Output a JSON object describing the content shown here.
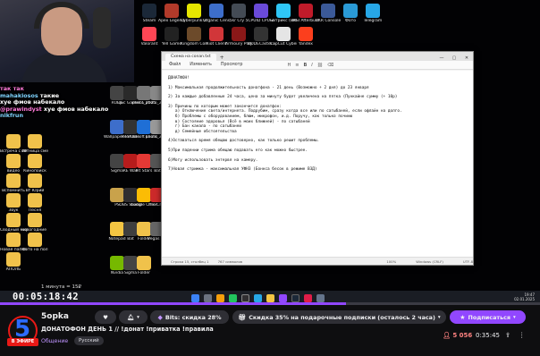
{
  "desktop": {
    "icons": [
      {
        "label": "Steam",
        "color": "#1b2838"
      },
      {
        "label": "Apex Legends",
        "color": "#b23a2a"
      },
      {
        "label": "Cyberpunk 2077",
        "color": "#e6e600"
      },
      {
        "label": "Organic Cens...",
        "color": "#3d6ecb"
      },
      {
        "label": "5kr Cry 5",
        "color": "#444b55"
      },
      {
        "label": "CPUID CPU-Z",
        "color": "#6a4ad9"
      },
      {
        "label": "Битрикс (Bitrix24)",
        "color": "#2fc6f6"
      },
      {
        "label": "MSI Afterburner",
        "color": "#c01b2a"
      },
      {
        "label": "VKR Console",
        "color": "#3b5998"
      },
      {
        "label": "Фото",
        "color": "#2a9ad6"
      },
      {
        "label": "Telegram",
        "color": "#27a7e7"
      },
      {
        "label": "Valorant",
        "color": "#ff4655"
      },
      {
        "label": "Yell Game",
        "color": "#222"
      },
      {
        "label": "Kingdom Come Deliv.",
        "color": "#6c4a2a"
      },
      {
        "label": "Riot Client",
        "color": "#d13639"
      },
      {
        "label": "Armoury Player",
        "color": "#8a1818"
      },
      {
        "label": "RODECaster App",
        "color": "#333"
      },
      {
        "label": "CapCut Cyber",
        "color": "#e5e5e5"
      },
      {
        "label": "Yandex",
        "color": "#fc3f1d"
      }
    ],
    "left_icons": [
      {
        "label": "RODE",
        "color": "#444"
      },
      {
        "label": "Epic Games Launcher",
        "color": "#2a2a2a"
      },
      {
        "label": "photo_2025",
        "color": "#777"
      },
      {
        "label": "photo_2025",
        "color": "#888"
      },
      {
        "label": "Zoom",
        "color": "#2d8cff"
      },
      {
        "label": "Wallpaper Eng.",
        "color": "#3d6ecb"
      },
      {
        "label": "ReShade",
        "color": "#333"
      },
      {
        "label": "Ubisoft Launcher",
        "color": "#1f6fd6"
      },
      {
        "label": "photo_2025",
        "color": "#999"
      },
      {
        "label": "TheTalo",
        "color": "#ffcc00"
      },
      {
        "label": "Sigma",
        "color": "#444"
      },
      {
        "label": "RE Wall",
        "color": "#b71c1c"
      },
      {
        "label": "Pit Stars",
        "color": "#e53935"
      },
      {
        "label": "Bat",
        "color": "#555"
      },
      {
        "label": "Sigma",
        "color": "#666"
      },
      {
        "label": "PS",
        "color": "#c9a24b"
      },
      {
        "label": "OBS Studio",
        "color": "#302e31"
      },
      {
        "label": "Google Chrome",
        "color": "#fbbc05"
      },
      {
        "label": "The Crew",
        "color": "#cc2a2a"
      },
      {
        "label": "NaVi",
        "color": "#f5d90a"
      },
      {
        "label": "Notepad",
        "color": "#f4c542"
      },
      {
        "label": "Bat",
        "color": "#3f3f3f"
      },
      {
        "label": "Folder",
        "color": "#f0c24b"
      },
      {
        "label": "Vegas Pro",
        "color": "#666"
      },
      {
        "label": "Folder",
        "color": "#f0c24b"
      },
      {
        "label": "Nvidia",
        "color": "#76b900"
      },
      {
        "label": "Sigma",
        "color": "#444"
      },
      {
        "label": "Folder",
        "color": "#f0c24b"
      }
    ],
    "left_labels": [
      "Встреча с ИИ...",
      "пятница смена 1",
      "видео",
      "Кинопоиск",
      "Вспомнить",
      "BY Юрий",
      "Звук",
      "Песня",
      "Сводный мир",
      "новогодние 1",
      "Новая папка",
      "Фото на пол",
      "АПОЛЬ"
    ]
  },
  "chat": [
    {
      "user": "так так",
      "text": "так так"
    },
    {
      "user": "mahakiosos",
      "text": "такие"
    },
    {
      "user": "",
      "text": "хуе фмов набекало"
    },
    {
      "user": "@prawindyst",
      "text": "хуе фмов набекало"
    },
    {
      "user": "nikfrun",
      "text": ""
    }
  ],
  "notepad": {
    "tab_label": "Схема на conan.txt",
    "menu": [
      "Файл",
      "Изменить",
      "Просмотр"
    ],
    "lines": [
      "ДОНАТФОН!",
      "",
      "1) Максимальная продолжительность донатфона - 21 день (Возможно + 2 дня) до 23 января",
      "",
      "2) За каждые добавленные 24 часа, цена за минуту будет увеличена на пятка (Пункайне сумму (+ 10р)",
      "",
      "3) Причины по которым может закончится донатфон:",
      "   а) Отключение света/интернета. Подрубим, сразу когда все или по сатыбаней, если офлайн на долго.",
      "   б) Проблемы с оборудованием, блюм, микрофон, и.д. Поручу, как только починю",
      "   в) Состояние здоровья (Всё в моих ближней) - по сатыбаней",
      "   г) Бан канала - по сатыбаней",
      "   д) Семейные обстоятельства",
      "",
      "4)Оставаться время обещаю достоверно, как только решит проблемы.",
      "",
      "5)При падении стрима обещаю подавать его как можно быстрее.",
      "",
      "6)Могу использовать энтервя на камеру.",
      "",
      "7)Новая стримка - максимальная УФНЗ (Боннса бесок в режиме B3Д)"
    ],
    "status": {
      "position": "Строка 15, столбец 1",
      "chars": "767 символов",
      "zoom": "100%",
      "eol": "Windows (CRLF)",
      "enc": "UTF-8"
    }
  },
  "taskbar": {
    "time": "19:47",
    "date": "02.01.2025"
  },
  "player": {
    "timer": "00:05:18:42",
    "volume_note": "1 минута = 15₽",
    "progress": 0.64
  },
  "stream": {
    "channel": "5opka",
    "title": "ДОНАТОФОН ДЕНЬ 1 // !донат !приватка !правила",
    "category": "Общение",
    "tag": "Русский",
    "live_badge": "В ЭФИРЕ",
    "bits_label": "Bits: скидка 28%",
    "gift_label": "Скидка 35% на подарочные подписки (осталось 2 часа)",
    "sub_label": "Подписаться",
    "viewers": "5 056",
    "uptime": "0:35:45"
  },
  "colors": {
    "accent": "#9147ff",
    "live": "#e91916",
    "viewers": "#ff8280"
  }
}
